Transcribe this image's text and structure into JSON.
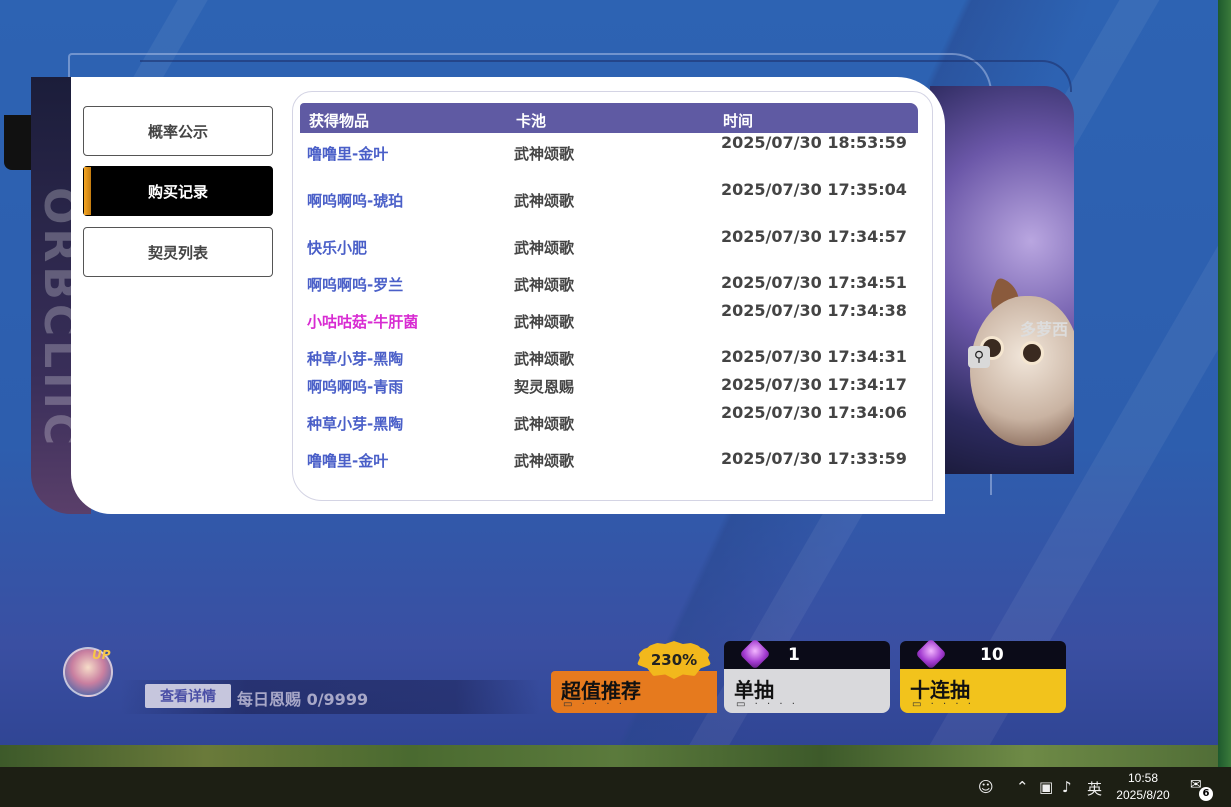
{
  "sidebar": {
    "items": [
      {
        "label": "概率公示",
        "active": false
      },
      {
        "label": "购买记录",
        "active": true
      },
      {
        "label": "契灵列表",
        "active": false
      }
    ]
  },
  "table": {
    "headers": {
      "item": "获得物品",
      "pool": "卡池",
      "time": "时间"
    },
    "rows": [
      {
        "item": "噜噜里-金叶",
        "pool": "武神颂歌",
        "time": "2025/07/30 18:53:59",
        "highlight": false
      },
      {
        "item": "啊呜啊呜-琥珀",
        "pool": "武神颂歌",
        "time": "2025/07/30 17:35:04",
        "highlight": false
      },
      {
        "item": "快乐小肥",
        "pool": "武神颂歌",
        "time": "2025/07/30 17:34:57",
        "highlight": false
      },
      {
        "item": "啊呜啊呜-罗兰",
        "pool": "武神颂歌",
        "time": "2025/07/30 17:34:51",
        "highlight": false
      },
      {
        "item": "小咕咕菇-牛肝菌",
        "pool": "武神颂歌",
        "time": "2025/07/30 17:34:38",
        "highlight": true
      },
      {
        "item": "种草小芽-黑陶",
        "pool": "武神颂歌",
        "time": "2025/07/30 17:34:31",
        "highlight": false
      },
      {
        "item": "啊呜啊呜-青雨",
        "pool": "契灵恩赐",
        "time": "2025/07/30 17:34:17",
        "highlight": false
      },
      {
        "item": "种草小芽-黑陶",
        "pool": "武神颂歌",
        "time": "2025/07/30 17:34:06",
        "highlight": false
      },
      {
        "item": "噜噜里-金叶",
        "pool": "武神颂歌",
        "time": "2025/07/30 17:33:59",
        "highlight": false
      }
    ]
  },
  "art": {
    "text": "多萝西"
  },
  "bottom": {
    "up_tag": "UP",
    "detail_button": "查看详情",
    "daily_grace": "每日恩赐 0/9999",
    "value_badge": "230%",
    "cards": [
      {
        "label": "超值推荐",
        "count": "",
        "color": "#e67a1e"
      },
      {
        "label": "单抽",
        "count": "1",
        "color": "#d9d9dc"
      },
      {
        "label": "十连抽",
        "count": "10",
        "color": "#f2c31c"
      }
    ],
    "dots": "▭ · · · ·"
  },
  "taskbar": {
    "ime": "英",
    "time": "10:58",
    "date": "2025/8/20",
    "notif_count": "6"
  },
  "colors": {
    "header_bg": "#5f5aa3",
    "item_text": "#4a5fc8",
    "item_highlight": "#d82bd2",
    "active_accent": "#f5a623"
  }
}
